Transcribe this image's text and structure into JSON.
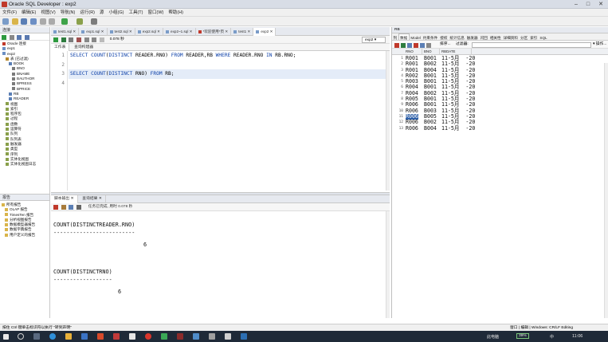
{
  "window": {
    "title": "Oracle SQL Developer : exp2"
  },
  "menu": [
    "文件(F)",
    "编辑(E)",
    "视图(V)",
    "导航(N)",
    "运行(R)",
    "源",
    "小组(G)",
    "工具(T)",
    "窗口(W)",
    "帮助(H)"
  ],
  "left_panel": {
    "tab": "连接",
    "tree": [
      "Oracle 连接",
      "exp1",
      "exp2",
      "表 (已过滤)",
      "BOOK",
      "BNO",
      "BNAME",
      "BAUTHOR",
      "BPRESS",
      "BPRICE",
      "RB",
      "READER",
      "视图",
      "索引",
      "程序包",
      "过程",
      "函数",
      "运算符",
      "队列",
      "队列表",
      "触发器",
      "类型",
      "序列",
      "实体化视图",
      "实体化视图日志"
    ]
  },
  "report_panel": {
    "tab": "报告",
    "tree": [
      "所有报告",
      "OLAP 报告",
      "TimesTen 报告",
      "分析视图报告",
      "数据模型器报告",
      "数据字典报告",
      "用户定义的报告"
    ]
  },
  "doc_tabs": [
    "test1.sql",
    "exp1.sql",
    "test2.sql",
    "exp2.sql",
    "exp2~1.sql",
    "*欢迎使用*页",
    "test1",
    "exp2"
  ],
  "editor": {
    "timing": "0.078 秒",
    "connection": "exp2",
    "subtabs": [
      "工作表",
      "查询构建器"
    ],
    "lines": [
      {
        "num": "1",
        "text": "SELECT COUNT(DISTINCT READER.RNO) FROM READER,RB WHERE READER.RNO IN RB.RNO;"
      },
      {
        "num": "2",
        "text": ""
      },
      {
        "num": "3",
        "text": "SELECT COUNT(DISTINCT RNO) FROM RB;"
      },
      {
        "num": "4",
        "text": ""
      }
    ]
  },
  "output": {
    "tabs": [
      "脚本输出",
      "查询结果"
    ],
    "status": "任务已完成, 用时 0.078 秒",
    "results": [
      {
        "header": "COUNT(DISTINCTREADER.RNO)",
        "separator": "-------------------------",
        "value": "6"
      },
      {
        "header": "COUNT(DISTINCTRNO)",
        "separator": "------------------",
        "value": "6"
      }
    ]
  },
  "right_panel": {
    "head": "RB",
    "tabs": [
      "列",
      "数据",
      "Model",
      "约束条件",
      "授权",
      "统计信息",
      "触发器",
      "闪回",
      "相关性",
      "详细资料",
      "分区",
      "索引",
      "SQL"
    ],
    "sort_label": "排序...",
    "filter_label": "过滤器:",
    "actions_label": "操作...",
    "columns": [
      "RNO",
      "BNO",
      "RBDATE"
    ],
    "rows": [
      {
        "n": "1",
        "rno": "R001",
        "bno": "B001",
        "date": "11-5月  -20"
      },
      {
        "n": "2",
        "rno": "R001",
        "bno": "B002",
        "date": "11-5月  -20"
      },
      {
        "n": "3",
        "rno": "R001",
        "bno": "B004",
        "date": "11-5月  -20"
      },
      {
        "n": "4",
        "rno": "R002",
        "bno": "B001",
        "date": "11-5月  -20"
      },
      {
        "n": "5",
        "rno": "R003",
        "bno": "B001",
        "date": "11-5月  -20"
      },
      {
        "n": "6",
        "rno": "R004",
        "bno": "B001",
        "date": "11-5月  -20"
      },
      {
        "n": "7",
        "rno": "R004",
        "bno": "B002",
        "date": "11-5月  -20"
      },
      {
        "n": "8",
        "rno": "R005",
        "bno": "B001",
        "date": "11-5月  -20"
      },
      {
        "n": "9",
        "rno": "R006",
        "bno": "B001",
        "date": "11-5月  -20"
      },
      {
        "n": "10",
        "rno": "R006",
        "bno": "B003",
        "date": "11-5月  -20"
      },
      {
        "n": "11",
        "rno": "R006",
        "bno": "B005",
        "date": "11-5月  -20"
      },
      {
        "n": "12",
        "rno": "R006",
        "bno": "B002",
        "date": "11-5月  -20"
      },
      {
        "n": "13",
        "rno": "R006",
        "bno": "B004",
        "date": "11-5月  -20"
      }
    ],
    "selected_row": "11"
  },
  "status_bar": {
    "left": "按住 Ctrl 键单击标识符以执行 \"转到声明\"",
    "right": "窗口 | 编辑 | Windows: CR/LF  Editing"
  },
  "taskbar": {
    "tray_text": "此电脑",
    "battery": "39%",
    "language": "中",
    "time": "11:06"
  },
  "colors": {
    "keyword": "#0b3fa8",
    "selection": "#2d5fa8",
    "taskbar": "#1f2a38"
  }
}
